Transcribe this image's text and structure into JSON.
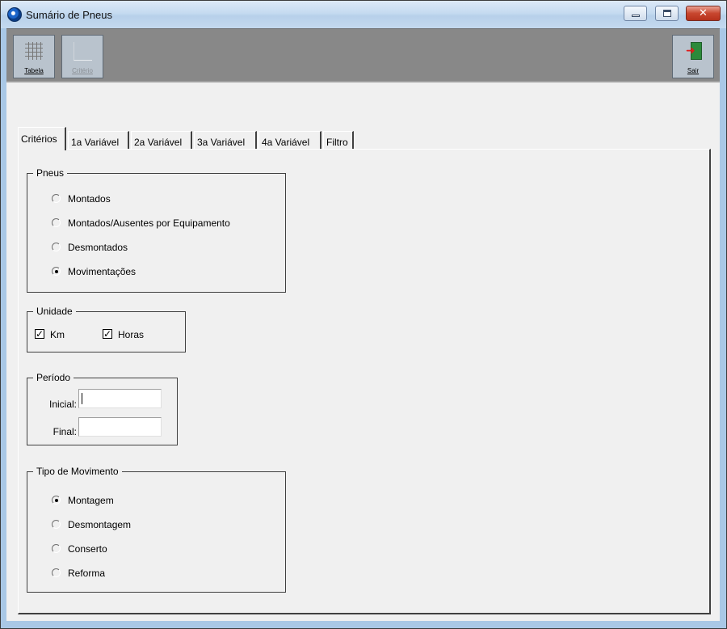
{
  "window": {
    "title": "Sumário de Pneus"
  },
  "toolbar": {
    "tabela_label": "Tabela",
    "criterio_label": "Critério",
    "sair_label": "Sair"
  },
  "tabs": [
    {
      "label": "Critérios",
      "active": true
    },
    {
      "label": "1a Variável"
    },
    {
      "label": "2a Variável"
    },
    {
      "label": "3a Variável"
    },
    {
      "label": "4a Variável"
    },
    {
      "label": "Filtro"
    }
  ],
  "pneus": {
    "legend": "Pneus",
    "options": [
      "Montados",
      "Montados/Ausentes por Equipamento",
      "Desmontados",
      "Movimentações"
    ],
    "selected": "Movimentações"
  },
  "unidade": {
    "legend": "Unidade",
    "km_label": "Km",
    "km_checked": true,
    "horas_label": "Horas",
    "horas_checked": true
  },
  "periodo": {
    "legend": "Período",
    "inicial_label": "Inicial:",
    "inicial_value": "",
    "final_label": "Final:",
    "final_value": ""
  },
  "tipo_movimento": {
    "legend": "Tipo de Movimento",
    "options": [
      "Montagem",
      "Desmontagem",
      "Conserto",
      "Reforma"
    ],
    "selected": "Montagem"
  },
  "colors": {
    "toolbar_bg": "#888888",
    "panel_bg": "#f0f0f0",
    "titlebar": "#c5daf0",
    "close_button": "#c8462f"
  }
}
